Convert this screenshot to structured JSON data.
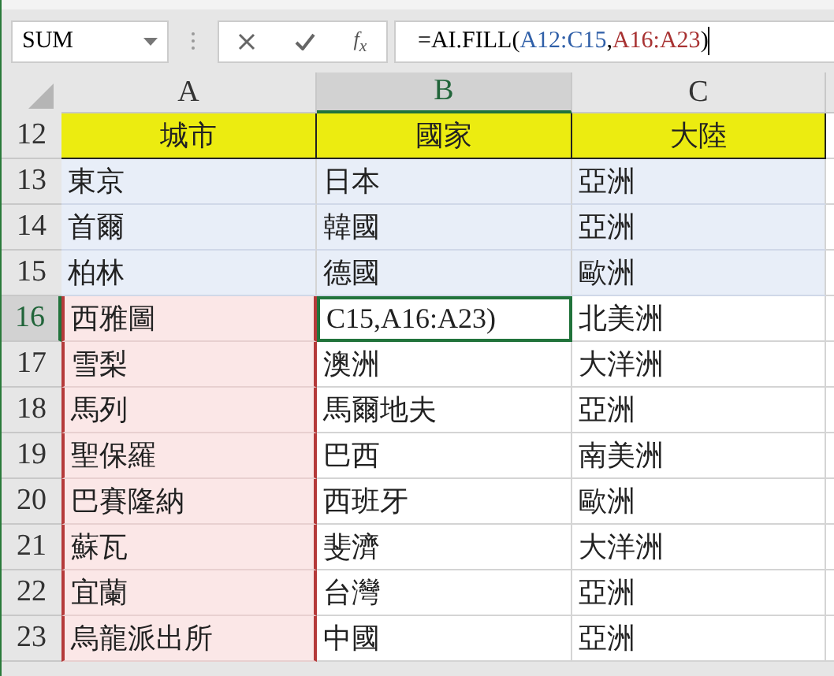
{
  "name_box": {
    "value": "SUM"
  },
  "formula_buttons": {
    "fx_label": "f$_{x}$"
  },
  "formula": [
    {
      "text": "=AI.FILL(",
      "color": "#000000"
    },
    {
      "text": "A12:C15",
      "color": "#2f5fa8"
    },
    {
      "text": ",",
      "color": "#000000"
    },
    {
      "text": "A16:A23",
      "color": "#a83232"
    },
    {
      "text": ")",
      "color": "#000000"
    }
  ],
  "columns": [
    {
      "label": "A",
      "selected": false
    },
    {
      "label": "B",
      "selected": true
    },
    {
      "label": "C",
      "selected": false
    }
  ],
  "rows": [
    {
      "number": "12",
      "selected": false,
      "cells": [
        {
          "text": "城市",
          "kind": "header"
        },
        {
          "text": "國家",
          "kind": "header"
        },
        {
          "text": "大陸",
          "kind": "header"
        }
      ]
    },
    {
      "number": "13",
      "selected": false,
      "cells": [
        {
          "text": "東京",
          "kind": "range1"
        },
        {
          "text": "日本",
          "kind": "range1"
        },
        {
          "text": "亞洲",
          "kind": "range1"
        }
      ]
    },
    {
      "number": "14",
      "selected": false,
      "cells": [
        {
          "text": "首爾",
          "kind": "range1"
        },
        {
          "text": "韓國",
          "kind": "range1"
        },
        {
          "text": "亞洲",
          "kind": "range1"
        }
      ]
    },
    {
      "number": "15",
      "selected": false,
      "cells": [
        {
          "text": "柏林",
          "kind": "range1"
        },
        {
          "text": "德國",
          "kind": "range1"
        },
        {
          "text": "歐洲",
          "kind": "range1"
        }
      ]
    },
    {
      "number": "16",
      "selected": true,
      "cells": [
        {
          "text": "西雅圖",
          "kind": "range2"
        },
        {
          "text": "C15,A16:A23)",
          "kind": "active"
        },
        {
          "text": "北美洲",
          "kind": "plain"
        }
      ]
    },
    {
      "number": "17",
      "selected": false,
      "cells": [
        {
          "text": "雪梨",
          "kind": "range2"
        },
        {
          "text": "澳洲",
          "kind": "plain"
        },
        {
          "text": "大洋洲",
          "kind": "plain"
        }
      ]
    },
    {
      "number": "18",
      "selected": false,
      "cells": [
        {
          "text": "馬列",
          "kind": "range2"
        },
        {
          "text": "馬爾地夫",
          "kind": "plain"
        },
        {
          "text": "亞洲",
          "kind": "plain"
        }
      ]
    },
    {
      "number": "19",
      "selected": false,
      "cells": [
        {
          "text": "聖保羅",
          "kind": "range2"
        },
        {
          "text": "巴西",
          "kind": "plain"
        },
        {
          "text": "南美洲",
          "kind": "plain"
        }
      ]
    },
    {
      "number": "20",
      "selected": false,
      "cells": [
        {
          "text": "巴賽隆納",
          "kind": "range2"
        },
        {
          "text": "西班牙",
          "kind": "plain"
        },
        {
          "text": "歐洲",
          "kind": "plain"
        }
      ]
    },
    {
      "number": "21",
      "selected": false,
      "cells": [
        {
          "text": "蘇瓦",
          "kind": "range2"
        },
        {
          "text": "斐濟",
          "kind": "plain"
        },
        {
          "text": "大洋洲",
          "kind": "plain"
        }
      ]
    },
    {
      "number": "22",
      "selected": false,
      "cells": [
        {
          "text": "宜蘭",
          "kind": "range2"
        },
        {
          "text": "台灣",
          "kind": "plain"
        },
        {
          "text": "亞洲",
          "kind": "plain"
        }
      ]
    },
    {
      "number": "23",
      "selected": false,
      "cells": [
        {
          "text": "烏龍派出所",
          "kind": "range2"
        },
        {
          "text": "中國",
          "kind": "plain"
        },
        {
          "text": "亞洲",
          "kind": "plain"
        }
      ]
    }
  ]
}
